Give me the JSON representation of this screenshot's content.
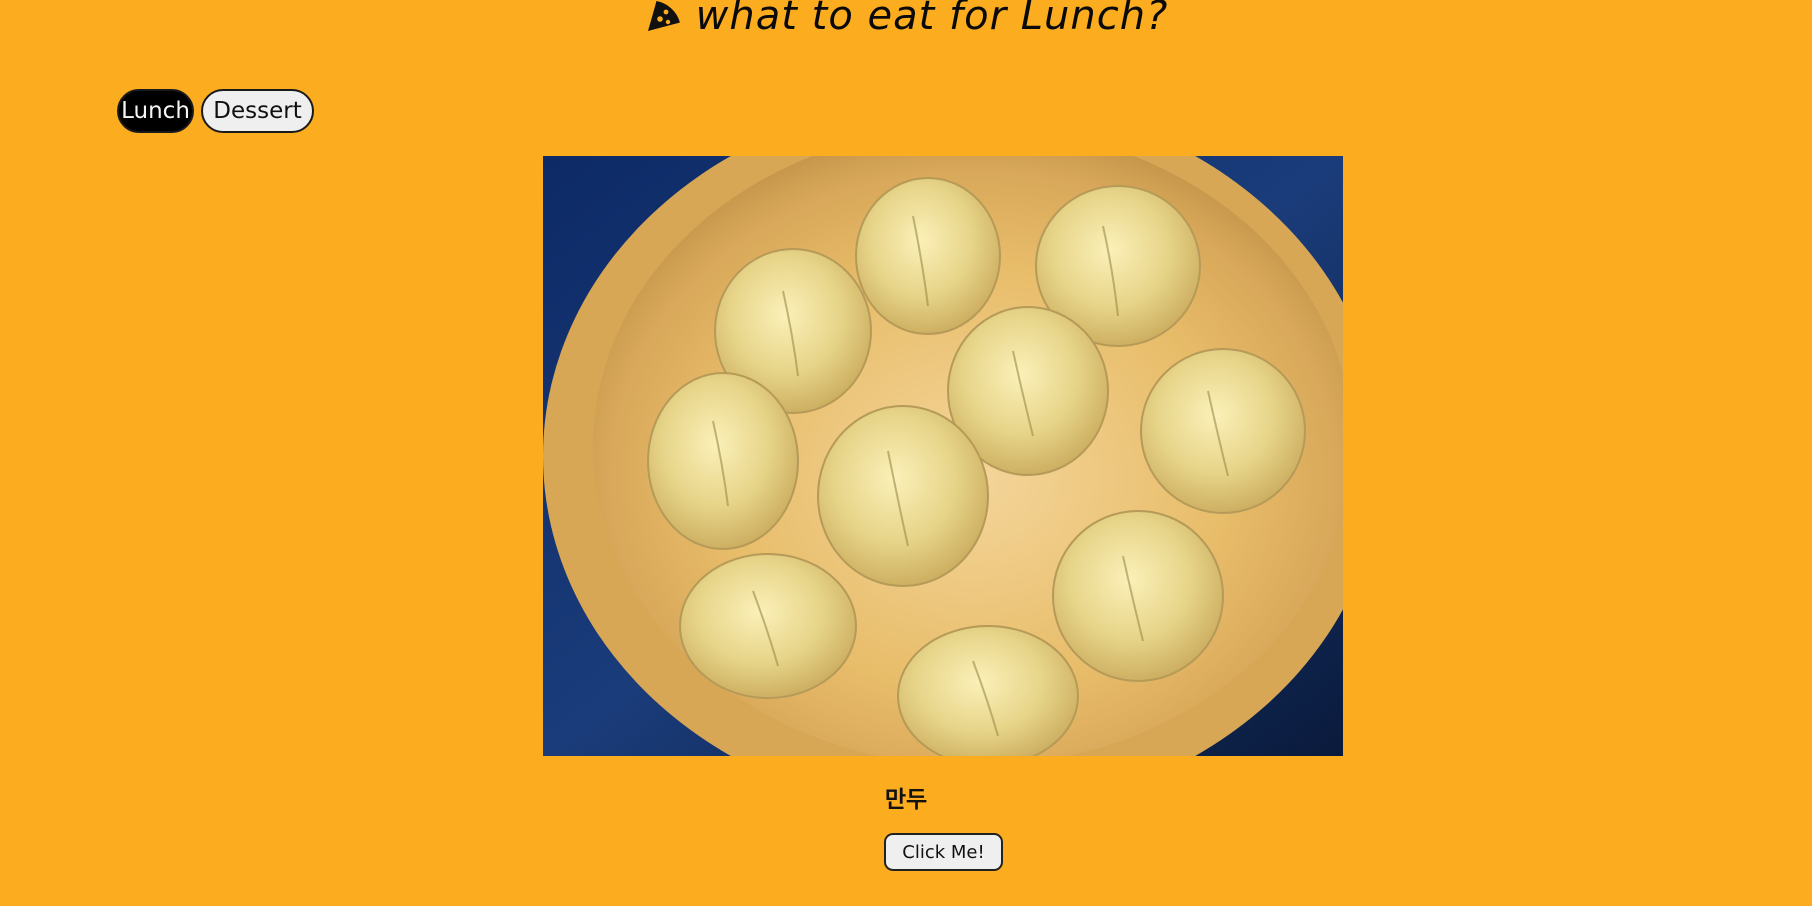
{
  "header": {
    "title": "what to eat for Lunch?",
    "icon": "pizza-slice-icon"
  },
  "tabs": [
    {
      "label": "Lunch",
      "active": true
    },
    {
      "label": "Dessert",
      "active": false
    }
  ],
  "food": {
    "name": "만두",
    "image_alt": "steamed dumplings in a bamboo steamer"
  },
  "action": {
    "button_label": "Click Me!"
  },
  "colors": {
    "background": "#FBAC1F",
    "active_tab": "#000000",
    "inactive_tab": "#EFEFEF"
  }
}
